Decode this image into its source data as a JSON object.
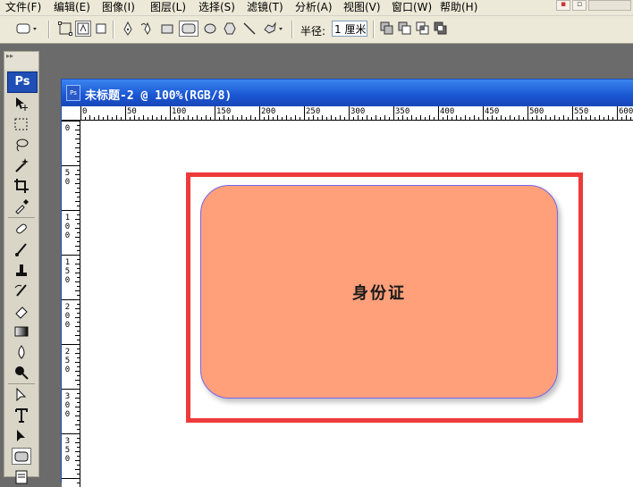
{
  "menu": [
    {
      "label": "文件(F)"
    },
    {
      "label": "编辑(E)"
    },
    {
      "label": "图像(I)"
    },
    {
      "label": "图层(L)"
    },
    {
      "label": "选择(S)"
    },
    {
      "label": "滤镜(T)"
    },
    {
      "label": "分析(A)"
    },
    {
      "label": "视图(V)"
    },
    {
      "label": "窗口(W)"
    },
    {
      "label": "帮助(H)"
    }
  ],
  "options_bar": {
    "radius_label": "半径:",
    "radius_value": "1 厘米",
    "active_shape": "rounded-rectangle"
  },
  "toolbox": {
    "logo": "Ps"
  },
  "document": {
    "title": "未标题-2 @ 100%(RGB/8)",
    "ruler_top_labels": [
      "0",
      "50",
      "100",
      "150",
      "200",
      "250",
      "300",
      "350",
      "400",
      "450",
      "500",
      "550",
      "600"
    ],
    "ruler_left_labels": [
      "0",
      "50",
      "100",
      "150",
      "200",
      "250",
      "300",
      "350"
    ]
  },
  "canvas": {
    "card_text": "身份证",
    "card_color": "#ffa07a",
    "frame_color": "#ee3a3a",
    "path_color": "#7763f0"
  },
  "colors": {
    "titlebar": "#1a56d2",
    "workspace": "#6b6b6b"
  }
}
